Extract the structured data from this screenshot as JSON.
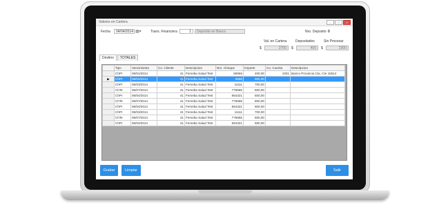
{
  "window": {
    "title": "Valores en Cartera"
  },
  "header": {
    "fecha_label": "Fecha",
    "fecha_value": "04/04/2014",
    "trans_label": "Trans. Financiera",
    "trans_num": "1",
    "trans_value": "Depósito en Banco",
    "nro_deposito_label": "Nro. Deposito",
    "nro_deposito_value": "0"
  },
  "totals": {
    "cartera_label": "Val. en Cartera",
    "depositados_label": "Depositados",
    "sinprocesar_label": "Sin Procesar",
    "currency": "$",
    "cartera_value": "2700",
    "depositados_value": "400",
    "sinprocesar_value": "2300"
  },
  "tabs": [
    "Destino",
    "TOTALES"
  ],
  "grid": {
    "columns": [
      "Tipo",
      "Vencimiento",
      "Co. Cliente",
      "Descripcion",
      "Nro. Cheque",
      "Importe",
      "Co. Cuenta",
      "Descripcion"
    ],
    "selected_indicator": "▶",
    "rows": [
      [
        "ChPr",
        "06/01/2014",
        "41",
        "Femeba Salud Test",
        "55555",
        "400,00",
        "1001",
        "Banco Provincia Cta. Cte 15512"
      ],
      [
        "ChPr",
        "06/02/2014",
        "41",
        "Femeba Salud Test",
        "6666",
        "500,00",
        "",
        ""
      ],
      [
        "ChPr",
        "06/03/2014",
        "41",
        "Femeba Salud Test",
        "11111",
        "700,00",
        "",
        ""
      ],
      [
        "ChTe",
        "06/07/2014",
        "41",
        "Femeba Salud Test",
        "776655",
        "600,00",
        "",
        ""
      ],
      [
        "ChPr",
        "06/04/2014",
        "41",
        "Femeba Salud Test",
        "654321",
        "500,00",
        "",
        ""
      ],
      [
        "ChTe",
        "06/07/2014",
        "41",
        "Femeba Salud Test",
        "776655",
        "600,00",
        "",
        ""
      ],
      [
        "ChPr",
        "06/04/2014",
        "41",
        "Femeba Salud Test",
        "654321",
        "500,00",
        "",
        ""
      ],
      [
        "ChPr",
        "06/03/2014",
        "41",
        "Femeba Salud Test",
        "11111",
        "700,00",
        "",
        ""
      ],
      [
        "ChTe",
        "06/07/2014",
        "41",
        "Femeba Salud Test",
        "776655",
        "600,00",
        "",
        ""
      ],
      [
        "ChPr",
        "06/04/2014",
        "41",
        "Femeba Salud Test",
        "654321",
        "500,00",
        "",
        ""
      ]
    ]
  },
  "buttons": {
    "grabar": "Grabar",
    "limpiar": "Limpiar",
    "salir": "Salir"
  },
  "colors": {
    "accent": "#2d8fe6",
    "selection": "#3399ff"
  }
}
